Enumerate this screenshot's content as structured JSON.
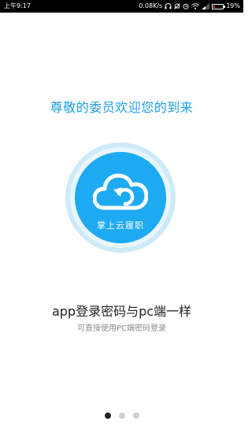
{
  "status_bar": {
    "time": "上午9:17",
    "network_speed": "0.08K/s",
    "battery_percent": "19%",
    "battery_level": 0.19,
    "icons": [
      "headset-icon",
      "mute-icon",
      "alarm-icon",
      "wifi-icon",
      "signal-icon",
      "battery-icon"
    ]
  },
  "welcome_text": "尊敬的委员欢迎您的到来",
  "logo": {
    "text": "掌上云履职",
    "icon": "cloud-sync-icon",
    "colors": {
      "primary": "#1daaf2",
      "halo": "#cdeaf9"
    }
  },
  "headline": "app登录密码与pc端一样",
  "subline": "可直接使用PC端密码登录",
  "pager": {
    "count": 3,
    "active_index": 0
  }
}
